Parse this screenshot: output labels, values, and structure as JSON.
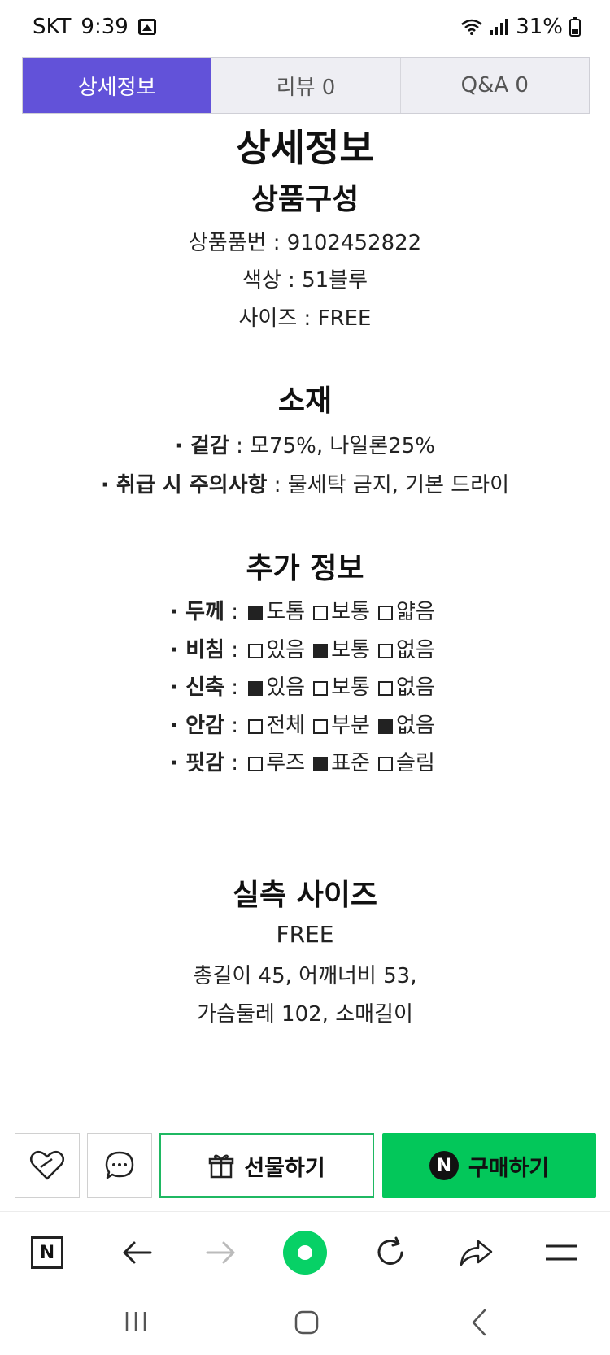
{
  "status": {
    "carrier": "SKT",
    "time": "9:39",
    "battery": "31%"
  },
  "tabs": [
    {
      "label": "상세정보",
      "active": true
    },
    {
      "label": "리뷰  0",
      "active": false
    },
    {
      "label": "Q&A  0",
      "active": false
    }
  ],
  "detail": {
    "title": "상세정보",
    "composition": {
      "heading": "상품구성",
      "lines": [
        {
          "key": "상품품번",
          "sep": " : ",
          "value": "9102452822"
        },
        {
          "key": "색상",
          "sep": " : ",
          "value": "51블루"
        },
        {
          "key": "사이즈",
          "sep": " : ",
          "value": "FREE"
        }
      ]
    },
    "material": {
      "heading": "소재",
      "lines": [
        {
          "key": "· 겉감",
          "sep": " : ",
          "value": "모75%, 나일론25%"
        },
        {
          "key": "· 취급 시 주의사항",
          "sep": " : ",
          "value": "물세탁 금지, 기본 드라이"
        }
      ]
    },
    "extra": {
      "heading": "추가 정보",
      "rows": [
        {
          "key": "· 두께",
          "options": [
            {
              "label": "도톰",
              "checked": true
            },
            {
              "label": "보통",
              "checked": false
            },
            {
              "label": "얇음",
              "checked": false
            }
          ]
        },
        {
          "key": "· 비침",
          "options": [
            {
              "label": "있음",
              "checked": false
            },
            {
              "label": "보통",
              "checked": true
            },
            {
              "label": "없음",
              "checked": false
            }
          ]
        },
        {
          "key": "· 신축",
          "options": [
            {
              "label": "있음",
              "checked": true
            },
            {
              "label": "보통",
              "checked": false
            },
            {
              "label": "없음",
              "checked": false
            }
          ]
        },
        {
          "key": "· 안감",
          "options": [
            {
              "label": "전체",
              "checked": false
            },
            {
              "label": "부분",
              "checked": false
            },
            {
              "label": "없음",
              "checked": true
            }
          ]
        },
        {
          "key": "· 핏감",
          "options": [
            {
              "label": "루즈",
              "checked": false
            },
            {
              "label": "표준",
              "checked": true
            },
            {
              "label": "슬림",
              "checked": false
            }
          ]
        }
      ]
    },
    "size": {
      "heading": "실측 사이즈",
      "label": "FREE",
      "line1": "총길이 45, 어깨너비 53,",
      "line2": "가슴둘레 102, 소매길이"
    }
  },
  "actions": {
    "gift_label": "선물하기",
    "buy_label": "구매하기",
    "buy_badge": "N"
  },
  "browser": {
    "n_label": "N"
  },
  "colors": {
    "tab_active": "#6252d9",
    "buy_green": "#03c75a",
    "gift_border": "#1fb862"
  }
}
